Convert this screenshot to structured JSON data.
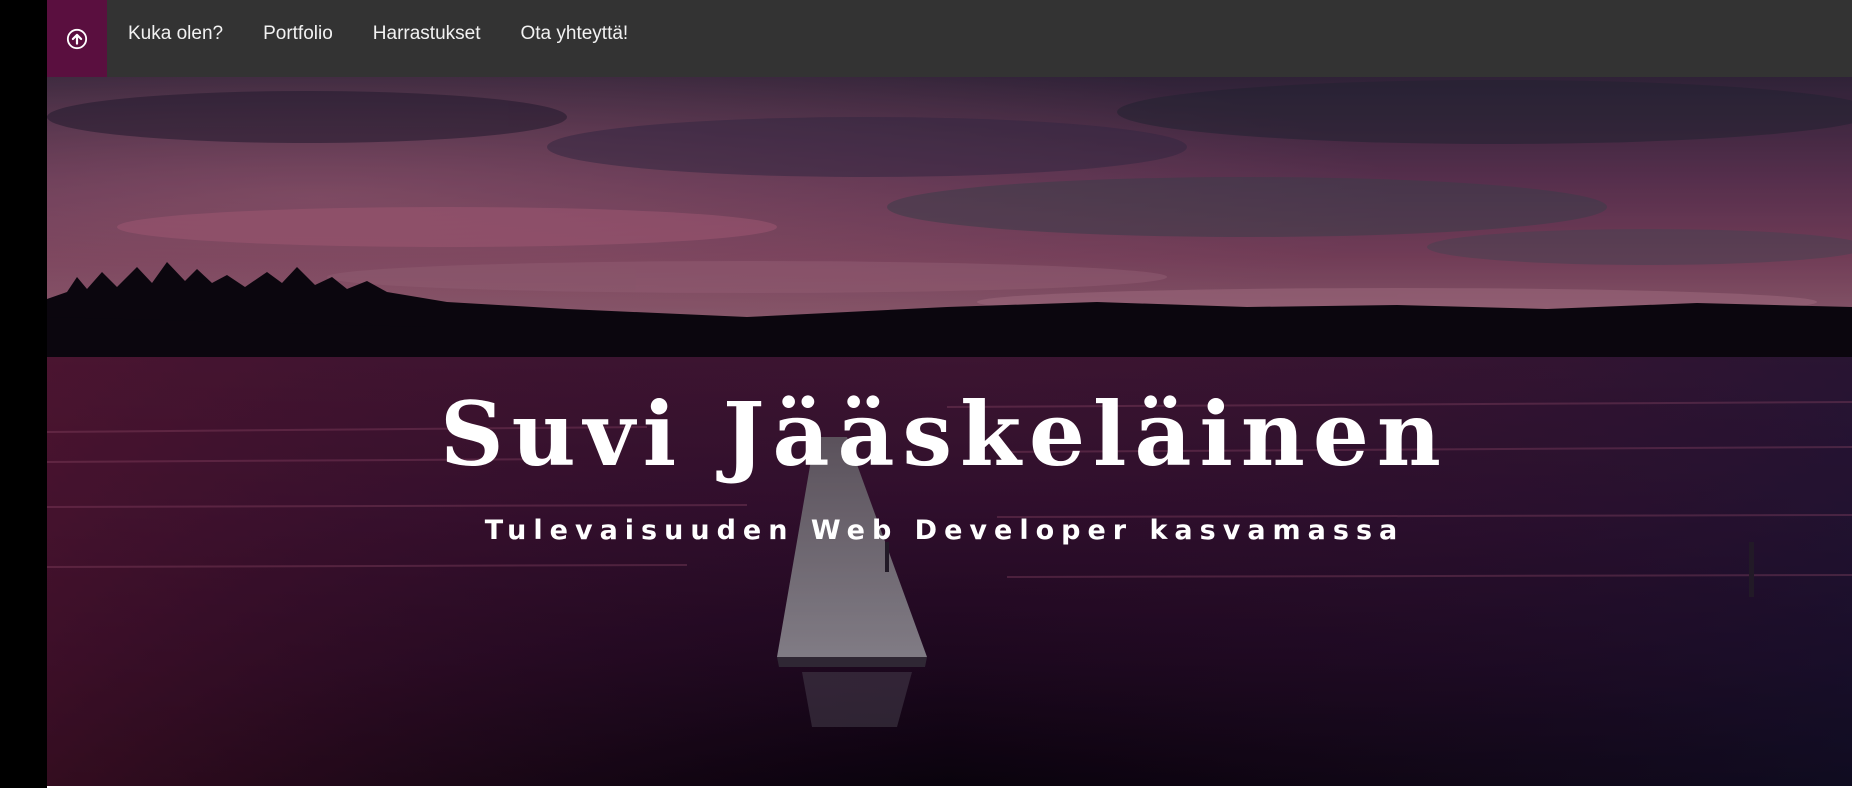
{
  "nav": {
    "home_icon": "arrow-up-circle-icon",
    "items": [
      {
        "label": "Kuka olen?"
      },
      {
        "label": "Portfolio"
      },
      {
        "label": "Harrastukset"
      },
      {
        "label": "Ota yhteyttä!"
      }
    ]
  },
  "hero": {
    "title": "Suvi Jääskeläinen",
    "subtitle": "Tulevaisuuden Web Developer kasvamassa"
  },
  "colors": {
    "navbar_bg": "#333333",
    "home_button_bg": "#5a0f3f",
    "nav_text": "#f2f2f2",
    "hero_text": "#ffffff"
  }
}
